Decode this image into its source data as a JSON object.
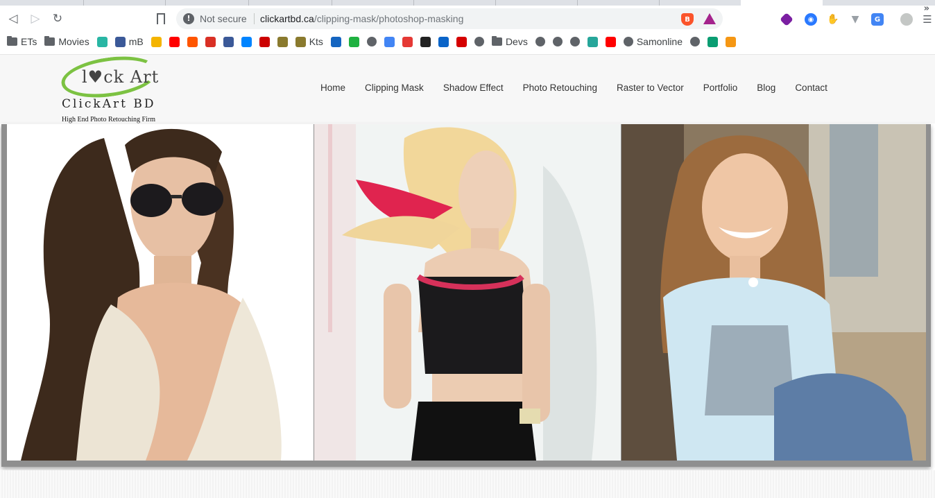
{
  "browser": {
    "security_label": "Not secure",
    "url_host": "clickartbd.ca",
    "url_path": "/clipping-mask/photoshop-masking",
    "colors": {
      "toolbar": "#ffffff",
      "omnibox": "#f1f3f4",
      "accent_brave": "#fb542b"
    }
  },
  "bookmarks": [
    {
      "label": "ETs",
      "icon": "folder-icon"
    },
    {
      "label": "Movies",
      "icon": "folder-icon"
    },
    {
      "label": "",
      "icon": "d-icon",
      "color": "#29b6a4"
    },
    {
      "label": "mB",
      "icon": "facebook-icon",
      "color": "#3b5998"
    },
    {
      "label": "",
      "icon": "drive-icon",
      "color": "#f4b400"
    },
    {
      "label": "",
      "icon": "youtube-icon",
      "color": "#ff0000"
    },
    {
      "label": "",
      "icon": "soundcloud-icon",
      "color": "#ff5500"
    },
    {
      "label": "",
      "icon": "gmail-icon",
      "color": "#d93025"
    },
    {
      "label": "",
      "icon": "facebook-icon",
      "color": "#3b5998"
    },
    {
      "label": "",
      "icon": "messenger-icon",
      "color": "#0084ff"
    },
    {
      "label": "",
      "icon": "m-icon",
      "color": "#cc0000"
    },
    {
      "label": "",
      "icon": "shield-icon",
      "color": "#8a7a2e"
    },
    {
      "label": "Kts",
      "icon": "shield-icon",
      "color": "#8a7a2e"
    },
    {
      "label": "",
      "icon": "t-icon",
      "color": "#1565c0"
    },
    {
      "label": "",
      "icon": "h-icon",
      "color": "#1fb141"
    },
    {
      "label": "",
      "icon": "globe-icon",
      "color": "#5f6368"
    },
    {
      "label": "",
      "icon": "google-icon",
      "color": "#4285f4"
    },
    {
      "label": "",
      "icon": "pdf-icon",
      "color": "#e53935"
    },
    {
      "label": "",
      "icon": "building-icon",
      "color": "#222222"
    },
    {
      "label": "",
      "icon": "outlook-icon",
      "color": "#0a64c8"
    },
    {
      "label": "",
      "icon": "drop-icon",
      "color": "#d50000"
    },
    {
      "label": "",
      "icon": "globe-icon",
      "color": "#5f6368"
    },
    {
      "label": "Devs",
      "icon": "folder-icon"
    },
    {
      "label": "",
      "icon": "globe-icon",
      "color": "#5f6368"
    },
    {
      "label": "",
      "icon": "globe-icon",
      "color": "#5f6368"
    },
    {
      "label": "",
      "icon": "globe-icon",
      "color": "#5f6368"
    },
    {
      "label": "",
      "icon": "circle-icon",
      "color": "#26a69a"
    },
    {
      "label": "",
      "icon": "youtube-icon",
      "color": "#ff0000"
    },
    {
      "label": "Samonline",
      "icon": "globe-icon",
      "color": "#5f6368"
    },
    {
      "label": "",
      "icon": "globe-icon",
      "color": "#5f6368"
    },
    {
      "label": "",
      "icon": "oval-icon",
      "color": "#0a9d72"
    },
    {
      "label": "",
      "icon": "xda-icon",
      "color": "#f59714"
    }
  ],
  "bookmarks_overflow": "»",
  "site": {
    "logo_mark": "l♥ck Art",
    "brand": "ClickArt BD",
    "tagline": "High End Photo Retouching Firm",
    "brand_color": "#7cc242",
    "nav": [
      "Home",
      "Clipping Mask",
      "Shadow Effect",
      "Photo Retouching",
      "Raster to Vector",
      "Portfolio",
      "Blog",
      "Contact"
    ]
  },
  "gallery": [
    {
      "name": "model-with-sunglasses"
    },
    {
      "name": "model-with-pink-streaked-hair"
    },
    {
      "name": "smiling-girl"
    }
  ]
}
